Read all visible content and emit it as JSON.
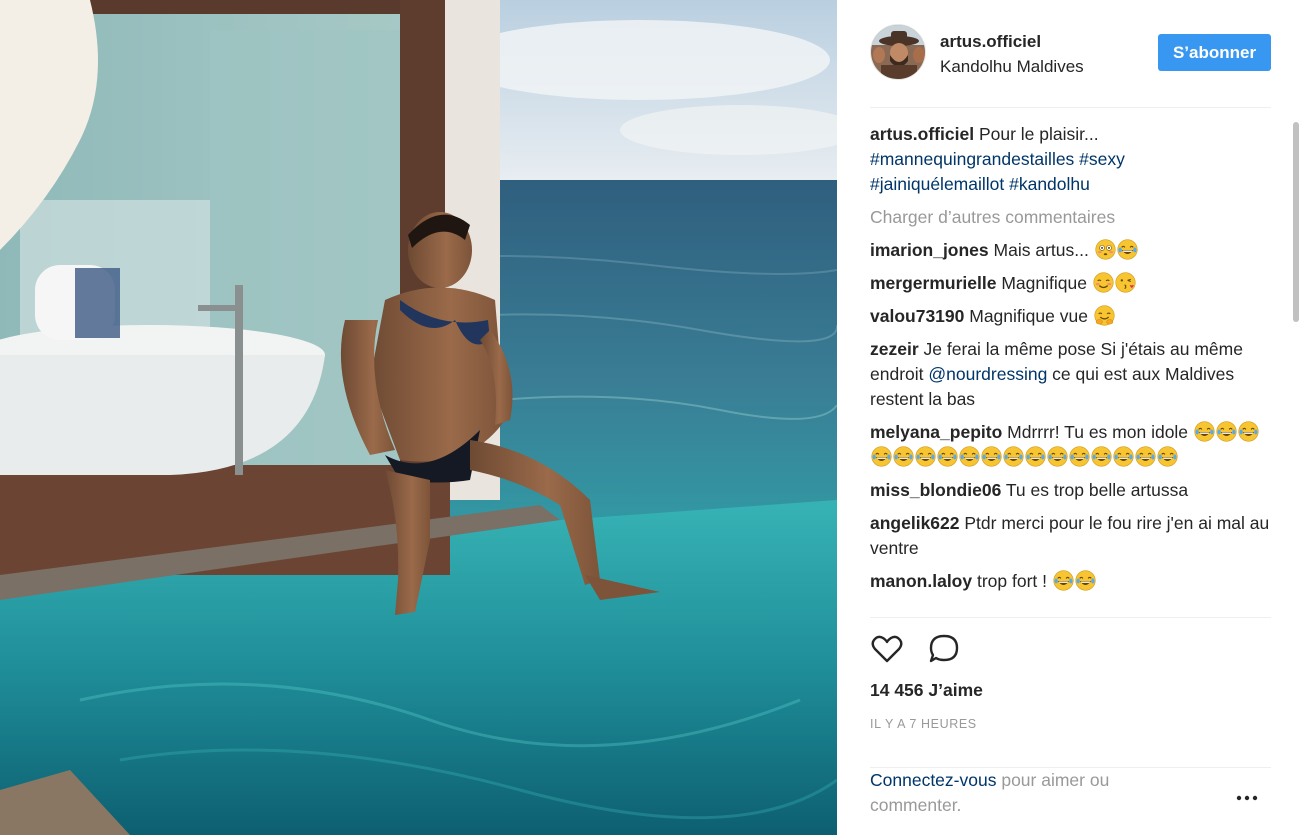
{
  "post": {
    "username": "artus.officiel",
    "location": "Kandolhu Maldives",
    "follow_label": "S’abonner",
    "caption_text": "Pour le plaisir...",
    "hashtags_line1": "#mannequingrandestailles #sexy",
    "hashtags_line2": "#jainiquélemaillot #kandolhu",
    "load_more": "Charger d’autres commentaires",
    "likes": "14 456 J’aime",
    "time": "IL Y A 7 HEURES",
    "login_link": "Connectez-vous",
    "login_rest": "pour aimer ou commenter."
  },
  "comments": [
    {
      "user": "imarion_jones",
      "text": "Mais artus...",
      "emojis": [
        "flushed",
        "joy"
      ]
    },
    {
      "user": "mergermurielle",
      "text": "Magnifique",
      "emojis": [
        "blush",
        "kiss"
      ]
    },
    {
      "user": "valou73190",
      "text": "Magnifique vue",
      "emojis": [
        "hug"
      ]
    },
    {
      "user": "zezeir",
      "text_before": "Je ferai la même pose Si j'étais au même endroit",
      "mention": "@nourdressing",
      "text_after": "ce qui est aux Maldives restent la bas",
      "emojis": []
    },
    {
      "user": "melyana_pepito",
      "text": "Mdrrrr! Tu es mon idole",
      "emojis": [
        "joy",
        "joy",
        "joy",
        "joy",
        "joy",
        "joy",
        "joy",
        "joy",
        "joy",
        "joy",
        "joy",
        "joy",
        "joy",
        "joy",
        "joy",
        "joy",
        "joy"
      ]
    },
    {
      "user": "miss_blondie06",
      "text": "Tu es trop belle artussa",
      "emojis": []
    },
    {
      "user": "angelik622",
      "text": "Ptdr merci pour le fou rire j'en ai mal au ventre",
      "emojis": []
    },
    {
      "user": "manon.laloy",
      "text": "trop fort !",
      "emojis": [
        "joy",
        "joy"
      ]
    }
  ],
  "icons": {
    "heart": "heart-icon",
    "comment": "comment-icon",
    "more": "more-options-icon"
  },
  "colors": {
    "follow_button": "#3897f0",
    "link": "#003569",
    "muted": "#999999"
  }
}
